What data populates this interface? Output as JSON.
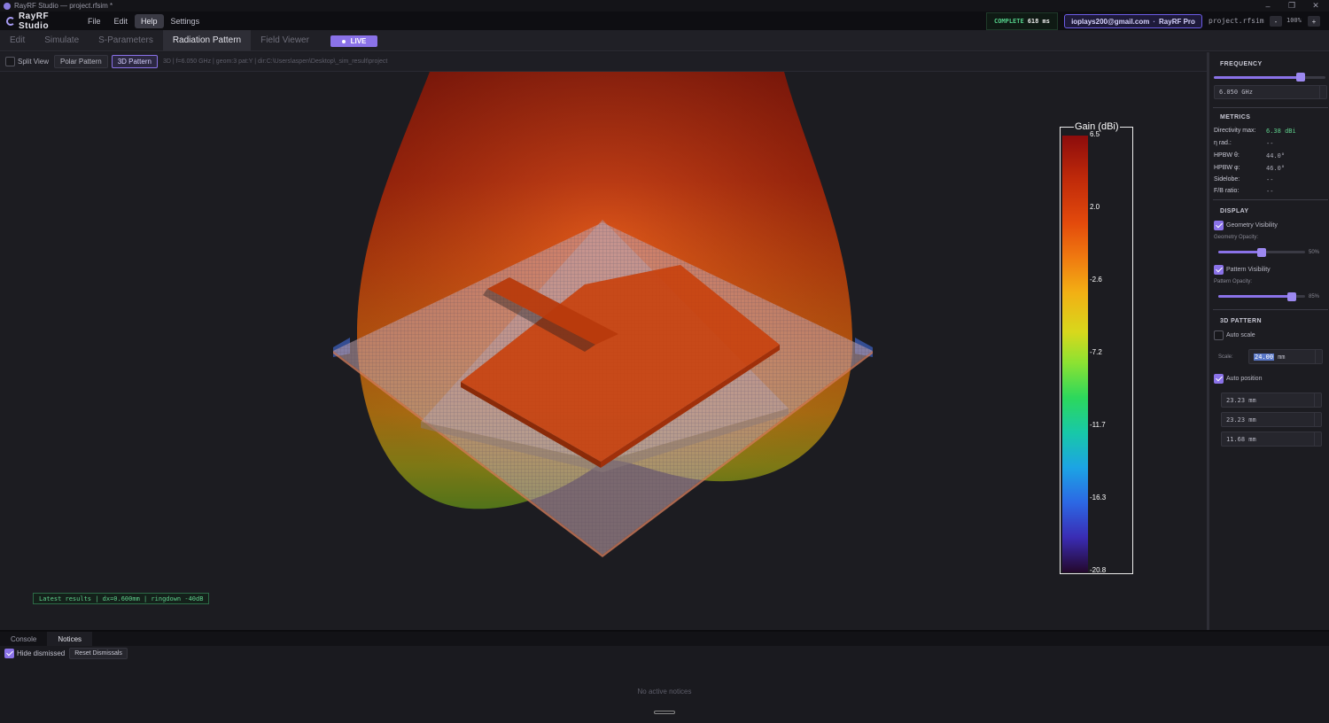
{
  "window": {
    "title": "RayRF Studio — project.rfsim *",
    "controls": [
      "–",
      "❐",
      "✕"
    ]
  },
  "menubar": {
    "brand": "RayRF Studio",
    "items": [
      "File",
      "Edit",
      "Help",
      "Settings"
    ],
    "active_item": "Help",
    "status_label": "COMPLETE",
    "status_time": "618 ms",
    "user_email": "ioplays200@gmail.com",
    "user_plan": "RayRF Pro",
    "user_sep": "·",
    "project_file": "project.rfsim",
    "zoom_minus": "-",
    "zoom_value": "100%",
    "zoom_plus": "+"
  },
  "tabs": {
    "items": [
      "Edit",
      "Simulate",
      "S-Parameters",
      "Radiation Pattern",
      "Field Viewer"
    ],
    "active": "Radiation Pattern",
    "live_label": "LIVE"
  },
  "toolbar": {
    "split_view": "Split View",
    "polar_pattern": "Polar Pattern",
    "pattern_3d": "3D Pattern",
    "info": "3D | f=6.050 GHz | geom:3 pat:Y | dir:C:\\Users\\aspen\\Desktop\\_sim_result\\project"
  },
  "viewport": {
    "latest_results": "Latest results | dx=0.600mm | ringdown -40dB"
  },
  "colorbar": {
    "title": "Gain (dBi)",
    "ticks": [
      "6.5",
      "2.0",
      "-2.6",
      "-7.2",
      "-11.7",
      "-16.3",
      "-20.8"
    ],
    "max": 6.5,
    "min": -20.8
  },
  "rightpanel": {
    "frequency": {
      "heading": "FREQUENCY",
      "slider_fraction": 0.78,
      "value": "6.050 GHz"
    },
    "metrics": {
      "heading": "METRICS",
      "rows": [
        {
          "label": "Directivity max:",
          "value": "6.38 dBi"
        },
        {
          "label": "η rad.:",
          "value": "--"
        },
        {
          "label": "HPBW θ:",
          "value": "44.0°"
        },
        {
          "label": "HPBW φ:",
          "value": "46.0°"
        },
        {
          "label": "Sidelobe:",
          "value": "--"
        },
        {
          "label": "F/B ratio:",
          "value": "--"
        }
      ]
    },
    "display": {
      "heading": "DISPLAY",
      "geometry_visibility": "Geometry Visibility",
      "geometry_opacity_label": "Geometry Opacity:",
      "geometry_opacity_pct": "50%",
      "geometry_opacity": 0.5,
      "pattern_visibility": "Pattern Visibility",
      "pattern_opacity_label": "Pattern Opacity:",
      "pattern_opacity_pct": "85%",
      "pattern_opacity": 0.85
    },
    "pattern3d": {
      "heading": "3D PATTERN",
      "auto_scale": "Auto scale",
      "auto_scale_checked": false,
      "scale_label": "Scale:",
      "scale_value": "24.00",
      "scale_unit": "mm",
      "auto_position": "Auto position",
      "auto_position_checked": true,
      "positions": [
        "23.23 mm",
        "23.23 mm",
        "11.68 mm"
      ]
    }
  },
  "bottom": {
    "tabs": [
      "Console",
      "Notices"
    ],
    "active_tab": "Notices",
    "hide_dismissed": "Hide dismissed",
    "reset_dismissals": "Reset Dismissals",
    "empty_text": "No active notices"
  },
  "colors": {
    "accent": "#8a72e8",
    "status_green": "#54d08a",
    "background": "#1a1a1f"
  }
}
